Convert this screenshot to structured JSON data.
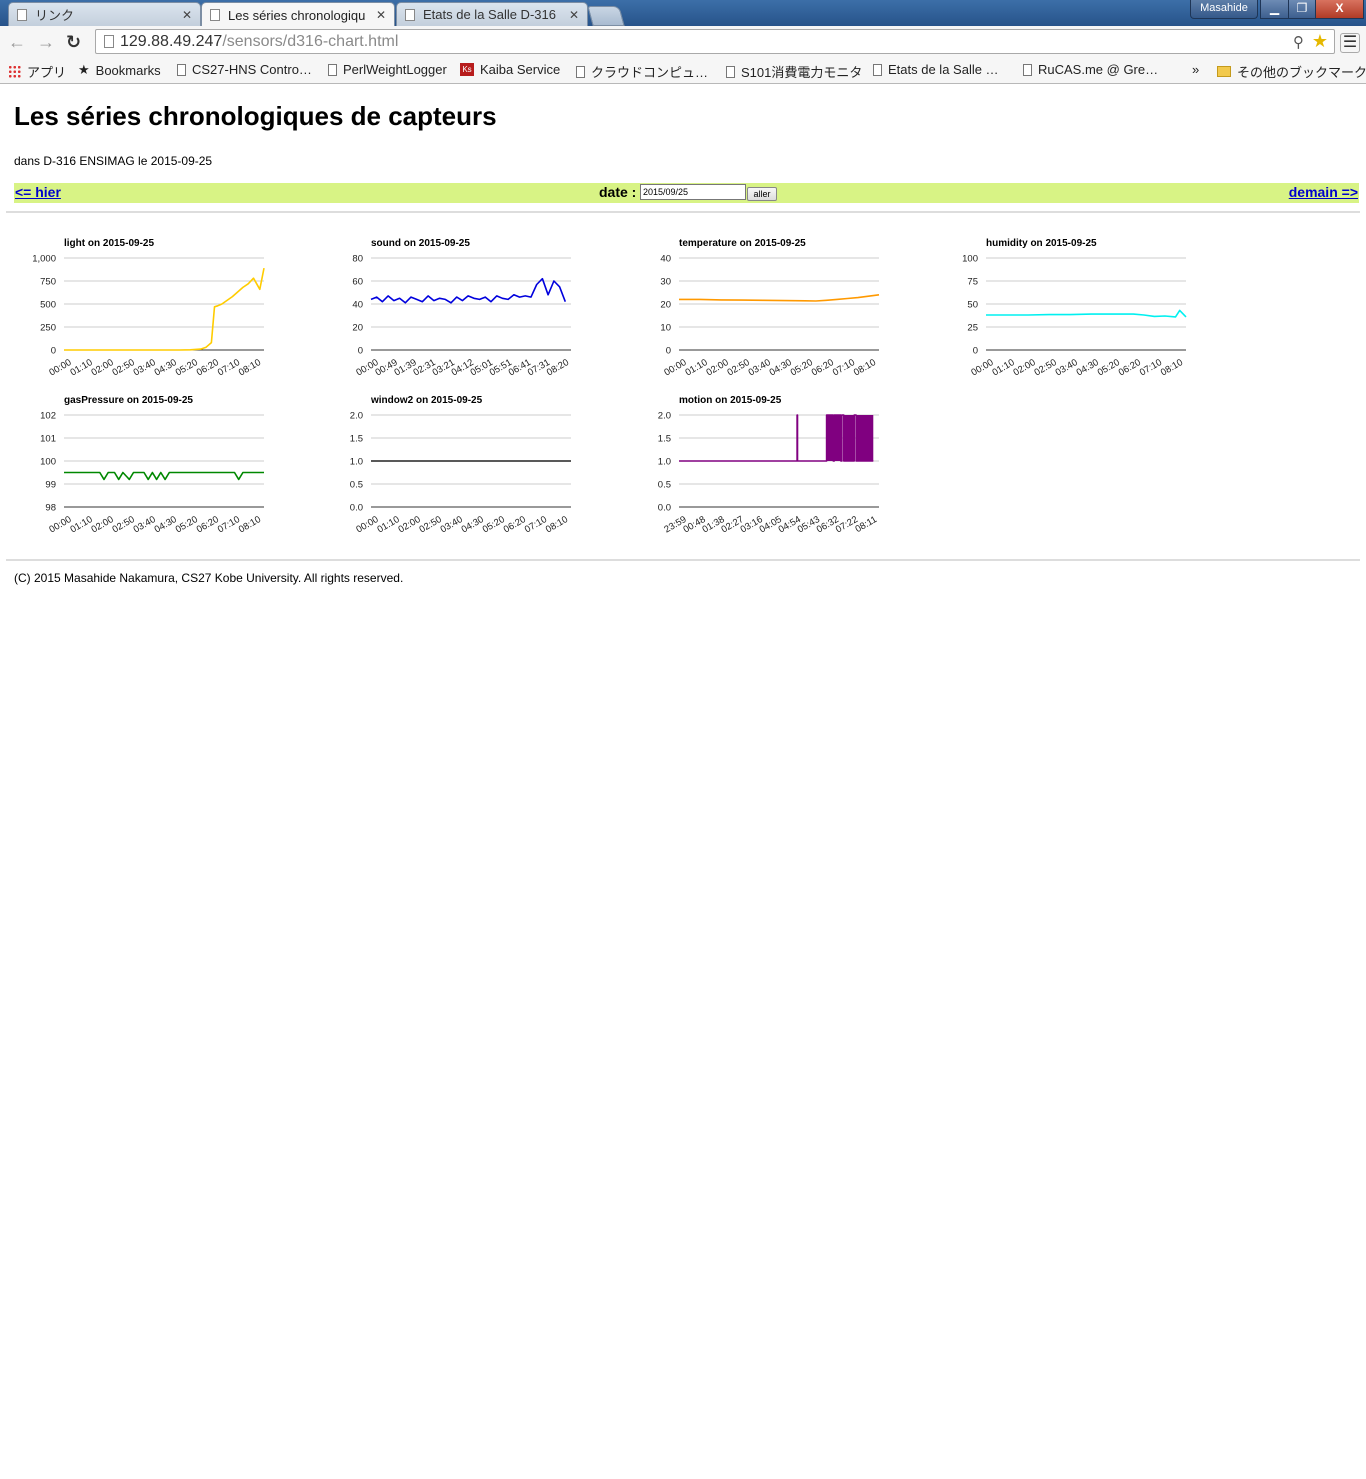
{
  "browser": {
    "tabs": [
      {
        "title": "リンク",
        "active": false
      },
      {
        "title": "Les séries chronologiqu",
        "active": true
      },
      {
        "title": "Etats de la Salle D-316",
        "active": false
      }
    ],
    "profile_name": "Masahide",
    "window_controls": {
      "minimize": "▁",
      "restore": "❐",
      "close": "X"
    },
    "url_host": "129.88.49.247",
    "url_path": "/sensors/d316-chart.html",
    "bookmarks": [
      {
        "label": "アプリ",
        "icon": "apps-grid-icon"
      },
      {
        "label": "Bookmarks",
        "icon": "star-icon"
      },
      {
        "label": "CS27-HNS Contro…",
        "icon": "page-icon"
      },
      {
        "label": "PerlWeightLogger",
        "icon": "page-icon"
      },
      {
        "label": "Kaiba Service",
        "icon": "kaiba-icon"
      },
      {
        "label": "クラウドコンピュ…",
        "icon": "page-icon"
      },
      {
        "label": "S101消費電力モニタ",
        "icon": "page-icon"
      },
      {
        "label": "Etats de la Salle …",
        "icon": "page-icon"
      },
      {
        "label": "RuCAS.me @ Gre…",
        "icon": "page-icon"
      }
    ],
    "bookmarks_overflow": "»",
    "other_bookmarks": "その他のブックマーク"
  },
  "page": {
    "title": "Les séries chronologiques de capteurs",
    "subtitle": "dans D-316 ENSIMAG le 2015-09-25",
    "nav": {
      "prev_label": "<= hier",
      "next_label": "demain =>",
      "date_label": "date :",
      "date_value": "2015/09/25",
      "go_label": "aller"
    },
    "footer": "(C) 2015 Masahide Nakamura, CS27 Kobe University. All rights reserved."
  },
  "chart_data": [
    {
      "type": "line",
      "title": "light on 2015-09-25",
      "color": "#ffcc00",
      "yticks": [
        "0",
        "250",
        "500",
        "750",
        "1,000"
      ],
      "ylim": [
        0,
        1000
      ],
      "xticks": [
        "00:00",
        "01:10",
        "02:00",
        "02:50",
        "03:40",
        "04:30",
        "05:20",
        "06:20",
        "07:10",
        "08:10"
      ],
      "x": [
        0,
        0.5,
        1,
        1.5,
        2,
        2.5,
        3,
        3.5,
        4,
        4.5,
        5,
        5.5,
        6,
        6.5,
        6.75,
        7,
        7.15,
        7.3,
        7.5,
        8,
        8.5,
        8.75,
        9,
        9.3,
        9.5
      ],
      "y": [
        0,
        0,
        0,
        0,
        0,
        0,
        0,
        0,
        0,
        0,
        0,
        0,
        2,
        10,
        30,
        80,
        470,
        480,
        500,
        580,
        680,
        720,
        780,
        660,
        890
      ]
    },
    {
      "type": "line",
      "title": "sound on 2015-09-25",
      "color": "#0000dd",
      "yticks": [
        "0",
        "20",
        "40",
        "60",
        "80"
      ],
      "ylim": [
        0,
        80
      ],
      "xticks": [
        "00:00",
        "00:49",
        "01:39",
        "02:31",
        "03:21",
        "04:12",
        "05:01",
        "05:51",
        "06:41",
        "07:31",
        "08:20"
      ],
      "x": [
        0,
        0.3,
        0.6,
        0.9,
        1.2,
        1.5,
        1.8,
        2.1,
        2.4,
        2.7,
        3.0,
        3.3,
        3.6,
        3.9,
        4.2,
        4.5,
        4.8,
        5.1,
        5.4,
        5.7,
        6.0,
        6.3,
        6.6,
        6.9,
        7.2,
        7.5,
        7.8,
        8.1,
        8.4,
        8.7,
        9.0,
        9.3,
        9.6,
        9.9,
        10.2
      ],
      "y": [
        44,
        46,
        42,
        47,
        43,
        45,
        41,
        46,
        44,
        42,
        47,
        43,
        45,
        44,
        41,
        46,
        43,
        47,
        45,
        44,
        46,
        42,
        47,
        45,
        44,
        48,
        46,
        47,
        46,
        57,
        62,
        48,
        60,
        55,
        42
      ]
    },
    {
      "type": "line",
      "title": "temperature on 2015-09-25",
      "color": "#ff9900",
      "yticks": [
        "0",
        "10",
        "20",
        "30",
        "40"
      ],
      "ylim": [
        0,
        40
      ],
      "xticks": [
        "00:00",
        "01:10",
        "02:00",
        "02:50",
        "03:40",
        "04:30",
        "05:20",
        "06:20",
        "07:10",
        "08:10"
      ],
      "x": [
        0,
        1,
        2,
        3,
        4,
        5,
        6,
        6.5,
        7,
        7.5,
        8,
        8.5,
        9,
        9.5
      ],
      "y": [
        22,
        22,
        21.8,
        21.7,
        21.6,
        21.5,
        21.4,
        21.3,
        21.6,
        22,
        22.4,
        22.8,
        23.4,
        24
      ]
    },
    {
      "type": "line",
      "title": "humidity on 2015-09-25",
      "color": "#00f0f0",
      "yticks": [
        "0",
        "25",
        "50",
        "75",
        "100"
      ],
      "ylim": [
        0,
        100
      ],
      "xticks": [
        "00:00",
        "01:10",
        "02:00",
        "02:50",
        "03:40",
        "04:30",
        "05:20",
        "06:20",
        "07:10",
        "08:10"
      ],
      "x": [
        0,
        1,
        2,
        3,
        4,
        5,
        6,
        7,
        7.5,
        8,
        8.5,
        9,
        9.2,
        9.5
      ],
      "y": [
        38,
        38,
        38,
        38.5,
        38.5,
        39,
        39,
        39,
        38,
        36.5,
        37,
        36,
        43,
        36
      ]
    },
    {
      "type": "line",
      "title": "gasPressure on 2015-09-25",
      "color": "#008800",
      "yticks": [
        "98",
        "99",
        "100",
        "101",
        "102"
      ],
      "ylim": [
        98,
        102
      ],
      "xticks": [
        "00:00",
        "01:10",
        "02:00",
        "02:50",
        "03:40",
        "04:30",
        "05:20",
        "06:20",
        "07:10",
        "08:10"
      ],
      "x": [
        0,
        1.7,
        1.9,
        2.1,
        2.4,
        2.6,
        2.8,
        3.1,
        3.3,
        3.8,
        4.0,
        4.2,
        4.4,
        4.6,
        4.8,
        5.0,
        5.2,
        5.5,
        8.1,
        8.3,
        8.5,
        9.5
      ],
      "y": [
        99.5,
        99.5,
        99.2,
        99.5,
        99.5,
        99.2,
        99.5,
        99.2,
        99.5,
        99.5,
        99.2,
        99.5,
        99.2,
        99.5,
        99.2,
        99.5,
        99.5,
        99.5,
        99.5,
        99.2,
        99.5,
        99.5
      ]
    },
    {
      "type": "line",
      "title": "window2 on 2015-09-25",
      "color": "#222222",
      "yticks": [
        "0.0",
        "0.5",
        "1.0",
        "1.5",
        "2.0"
      ],
      "ylim": [
        0,
        2
      ],
      "xticks": [
        "00:00",
        "01:10",
        "02:00",
        "02:50",
        "03:40",
        "04:30",
        "05:20",
        "06:20",
        "07:10",
        "08:10"
      ],
      "x": [
        0,
        9.5
      ],
      "y": [
        1,
        1
      ]
    },
    {
      "type": "line",
      "title": "motion on 2015-09-25",
      "color": "#800080",
      "yticks": [
        "0.0",
        "0.5",
        "1.0",
        "1.5",
        "2.0"
      ],
      "ylim": [
        0,
        2
      ],
      "xticks": [
        "23:59",
        "00:48",
        "01:38",
        "02:27",
        "03:16",
        "04:05",
        "04:54",
        "05:43",
        "06:32",
        "07:22",
        "08:11"
      ],
      "x": [
        0,
        6.2,
        6.2,
        6.22,
        6.22,
        7.75,
        7.75,
        8.1,
        8.1,
        8.15,
        8.15,
        8.5,
        8.5,
        8.55,
        8.55,
        8.65,
        8.65,
        9.2,
        9.2,
        9.3,
        9.3,
        10.2
      ],
      "y": [
        1,
        1,
        2,
        2,
        1,
        1,
        2,
        2,
        1,
        1,
        2,
        2,
        1,
        1,
        2,
        2,
        1,
        1,
        2,
        2,
        1,
        1
      ],
      "filled_bands": [
        [
          7.75,
          8.1
        ],
        [
          8.15,
          8.5
        ],
        [
          8.65,
          9.2
        ],
        [
          9.3,
          10.2
        ]
      ]
    }
  ]
}
